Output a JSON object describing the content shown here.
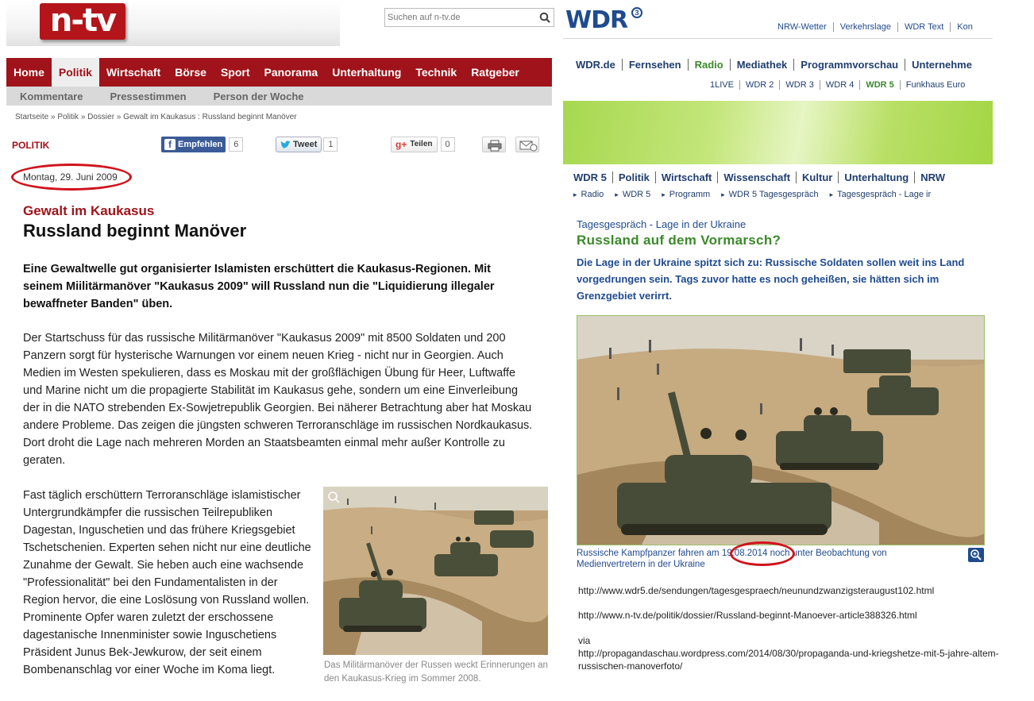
{
  "ntv": {
    "logo": "n-tv",
    "search_placeholder": "Suchen auf n-tv.de",
    "nav": [
      "Home",
      "Politik",
      "Wirtschaft",
      "Börse",
      "Sport",
      "Panorama",
      "Unterhaltung",
      "Technik",
      "Ratgeber"
    ],
    "nav_active": "Politik",
    "subnav": [
      "Kommentare",
      "Pressestimmen",
      "Person der Woche"
    ],
    "breadcrumb": "Startseite » Politik » Dossier » Gewalt im Kaukasus : Russland beginnt Manöver",
    "section": "POLITIK",
    "share": {
      "facebook_label": "Empfehlen",
      "facebook_count": "6",
      "twitter_label": "Tweet",
      "twitter_count": "1",
      "gplus_label": "Teilen",
      "gplus_count": "0"
    },
    "date": "Montag, 29. Juni 2009",
    "kicker": "Gewalt im Kaukasus",
    "title": "Russland beginnt Manöver",
    "lead": "Eine Gewaltwelle gut organisierter Islamisten erschüttert die Kaukasus-Regionen. Mit seinem Miilitärmanöver \"Kaukasus 2009\" will Russland nun die \"Liquidierung illegaler bewaffneter Banden\" üben.",
    "body1": "Der Startschuss für das russische Militärmanöver \"Kaukasus 2009\" mit 8500 Soldaten und 200 Panzern sorgt für hysterische Warnungen vor einem neuen Krieg - nicht nur in Georgien. Auch Medien im Westen spekulieren, dass es Moskau mit der großflächigen Übung für Heer, Luftwaffe und Marine nicht um die propagierte Stabilität im Kaukasus gehe, sondern um eine Einverleibung der in die NATO strebenden Ex-Sowjetrepublik Georgien. Bei näherer Betrachtung aber hat Moskau andere Probleme. Das zeigen die jüngsten schweren Terroranschläge im russischen Nordkaukasus. Dort droht die Lage nach mehreren Morden an Staatsbeamten einmal mehr außer Kontrolle zu geraten.",
    "body2": "Fast täglich erschüttern Terroranschläge islamistischer Untergrundkämpfer die russischen Teilrepubliken Dagestan, Inguschetien und das frühere Kriegsgebiet Tschetschenien. Experten sehen nicht nur eine deutliche Zunahme der Gewalt. Sie heben auch eine wachsende \"Professionalität\" bei den Fundamentalisten in der Region hervor, die eine Loslösung von Russland wollen. Prominente Opfer waren zuletzt der erschossene dagestanische Innenminister sowie Inguschetiens Präsident Junus Bek-Jewkurow, der seit einem Bombenanschlag vor einer Woche im Koma liegt.",
    "caption": "Das Militärmanöver der Russen weckt Erinnerungen an den Kaukasus-Krieg im Sommer 2008."
  },
  "wdr": {
    "logo": "WDR",
    "logo_mark": "3",
    "topnav": [
      "NRW-Wetter",
      "Verkehrslage",
      "WDR Text",
      "Kon"
    ],
    "mainnav": [
      "WDR.de",
      "Fernsehen",
      "Radio",
      "Mediathek",
      "Programmvorschau",
      "Unternehme"
    ],
    "mainnav_active": "Radio",
    "subnav": [
      "1LIVE",
      "WDR 2",
      "WDR 3",
      "WDR 4",
      "WDR 5",
      "Funkhaus Euro"
    ],
    "subnav_active": "WDR 5",
    "nav2": [
      "WDR 5",
      "Politik",
      "Wirtschaft",
      "Wissenschaft",
      "Kultur",
      "Unterhaltung",
      "NRW"
    ],
    "crumbs": [
      "Radio",
      "WDR 5",
      "Programm",
      "WDR 5 Tagesgespräch",
      "Tagesgespräch - Lage ir"
    ],
    "kicker": "Tagesgespräch - Lage in der Ukraine",
    "title": "Russland auf dem Vormarsch?",
    "lead": "Die Lage in der Ukraine spitzt sich zu: Russische Soldaten sollen weit ins Land vorgedrungen sein. Tags zuvor hatte es noch geheißen, sie hätten sich im Grenzgebiet verirrt.",
    "caption_pre": "Russische Kampfpanzer fahren am ",
    "caption_date": "19.08.2014",
    "caption_post": " noch unter Beobachtung von Medienvertretern in der Ukraine"
  },
  "links": {
    "url1": "http://www.wdr5.de/sendungen/tagesgespraech/neunundzwanzigsteraugust102.html",
    "url2": "http://www.n-tv.de/politik/dossier/Russland-beginnt-Manoever-article388326.html",
    "via": "via",
    "url3a": "http://propagandaschau.wordpress.com/2014/08/30/propaganda-und-kriegshetze-mit-5-jahre-altem-",
    "url3b": "russischen-manoverfoto/"
  }
}
